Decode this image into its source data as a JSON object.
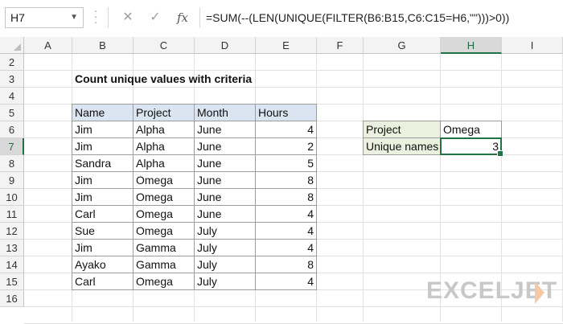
{
  "formula_bar": {
    "name_box": "H7",
    "cancel_glyph": "✕",
    "enter_glyph": "✓",
    "fx_label": "fx",
    "formula": "=SUM(--(LEN(UNIQUE(FILTER(B6:B15,C6:C15=H6,\"\")))>0))"
  },
  "columns": [
    "A",
    "B",
    "C",
    "D",
    "E",
    "F",
    "G",
    "H",
    "I"
  ],
  "rows": [
    "2",
    "3",
    "4",
    "5",
    "6",
    "7",
    "8",
    "9",
    "10",
    "11",
    "12",
    "13",
    "14",
    "15",
    "16"
  ],
  "selected": {
    "column": "H",
    "row": "7"
  },
  "sheet": {
    "title": "Count unique values with criteria",
    "table_headers": [
      "Name",
      "Project",
      "Month",
      "Hours"
    ],
    "table_rows": [
      {
        "name": "Jim",
        "project": "Alpha",
        "month": "June",
        "hours": "4"
      },
      {
        "name": "Jim",
        "project": "Alpha",
        "month": "June",
        "hours": "2"
      },
      {
        "name": "Sandra",
        "project": "Alpha",
        "month": "June",
        "hours": "5"
      },
      {
        "name": "Jim",
        "project": "Omega",
        "month": "June",
        "hours": "8"
      },
      {
        "name": "Jim",
        "project": "Omega",
        "month": "June",
        "hours": "8"
      },
      {
        "name": "Carl",
        "project": "Omega",
        "month": "June",
        "hours": "4"
      },
      {
        "name": "Sue",
        "project": "Omega",
        "month": "July",
        "hours": "4"
      },
      {
        "name": "Jim",
        "project": "Gamma",
        "month": "July",
        "hours": "4"
      },
      {
        "name": "Ayako",
        "project": "Gamma",
        "month": "July",
        "hours": "8"
      },
      {
        "name": "Carl",
        "project": "Omega",
        "month": "July",
        "hours": "4"
      }
    ],
    "criteria": {
      "project_label": "Project",
      "project_value": "Omega",
      "result_label": "Unique names",
      "result_value": "3"
    }
  },
  "colors": {
    "header_fill": "#dbe5f1",
    "label_fill": "#ebf1de",
    "selection_green": "#217346"
  },
  "logo": {
    "text": "EXCELJET"
  }
}
